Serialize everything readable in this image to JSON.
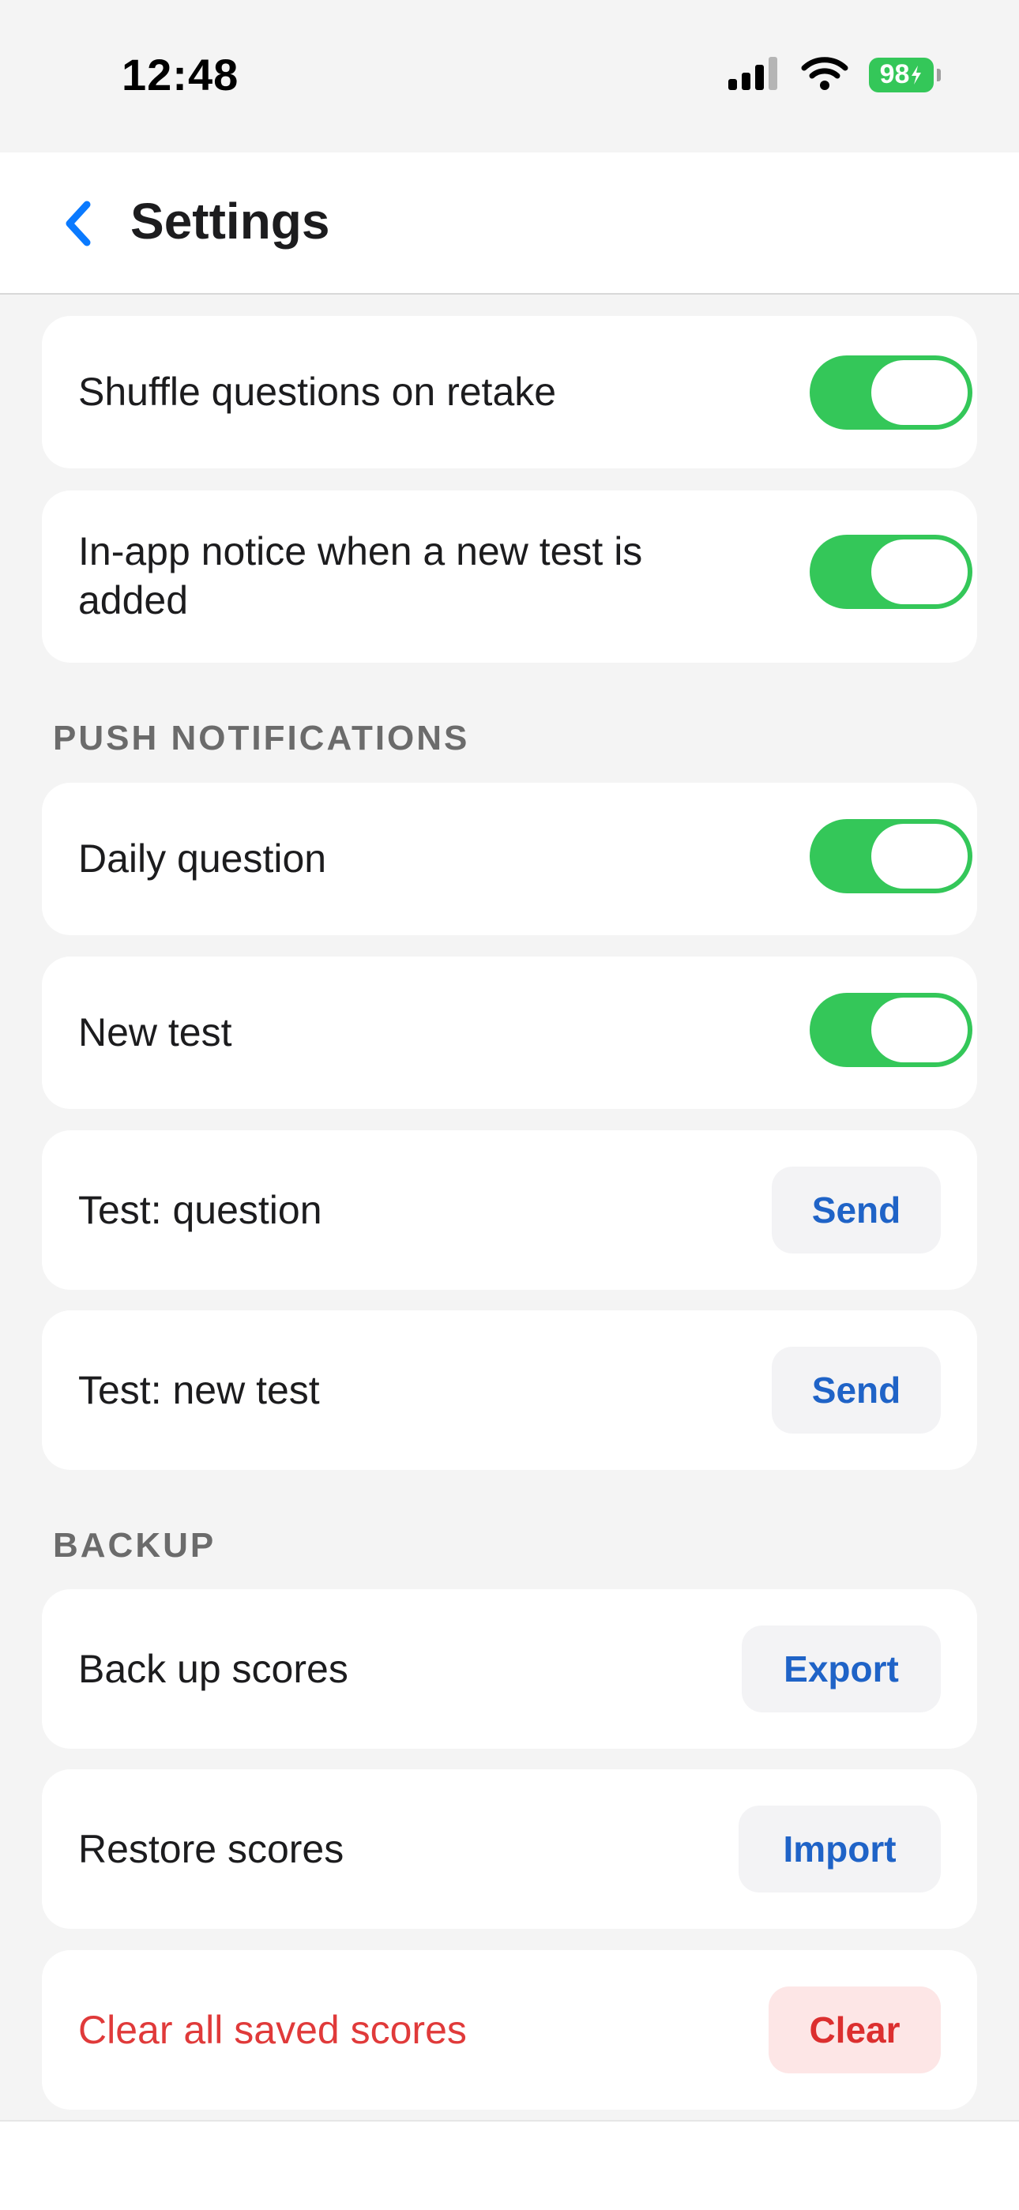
{
  "status_bar": {
    "time": "12:48",
    "battery": "98",
    "icons": [
      "cellular-signal-icon",
      "wifi-icon",
      "battery-charging-icon"
    ]
  },
  "nav": {
    "back_icon": "chevron-left-icon",
    "title": "Settings",
    "accent_color": "#0a7aff"
  },
  "general": {
    "shuffle_label": "Shuffle questions on retake",
    "shuffle_on": true,
    "new_test_notice_label": "In-app notice when a new test is added",
    "new_test_notice_on": true
  },
  "push_notifications": {
    "header": "PUSH NOTIFICATIONS",
    "daily_question_label": "Daily question",
    "daily_question_on": true,
    "new_test_label": "New test",
    "new_test_on": true,
    "test_question_label": "Test: question",
    "test_question_button": "Send",
    "test_new_test_label": "Test: new test",
    "test_new_test_button": "Send"
  },
  "backup": {
    "header": "BACKUP",
    "backup_label": "Back up scores",
    "backup_button": "Export",
    "restore_label": "Restore scores",
    "restore_button": "Import",
    "clear_label": "Clear all saved scores",
    "clear_button": "Clear"
  },
  "colors": {
    "toggle_on": "#34c759",
    "action_blue": "#1f63c7",
    "danger_red": "#e03a3a",
    "background": "#f4f4f4"
  }
}
